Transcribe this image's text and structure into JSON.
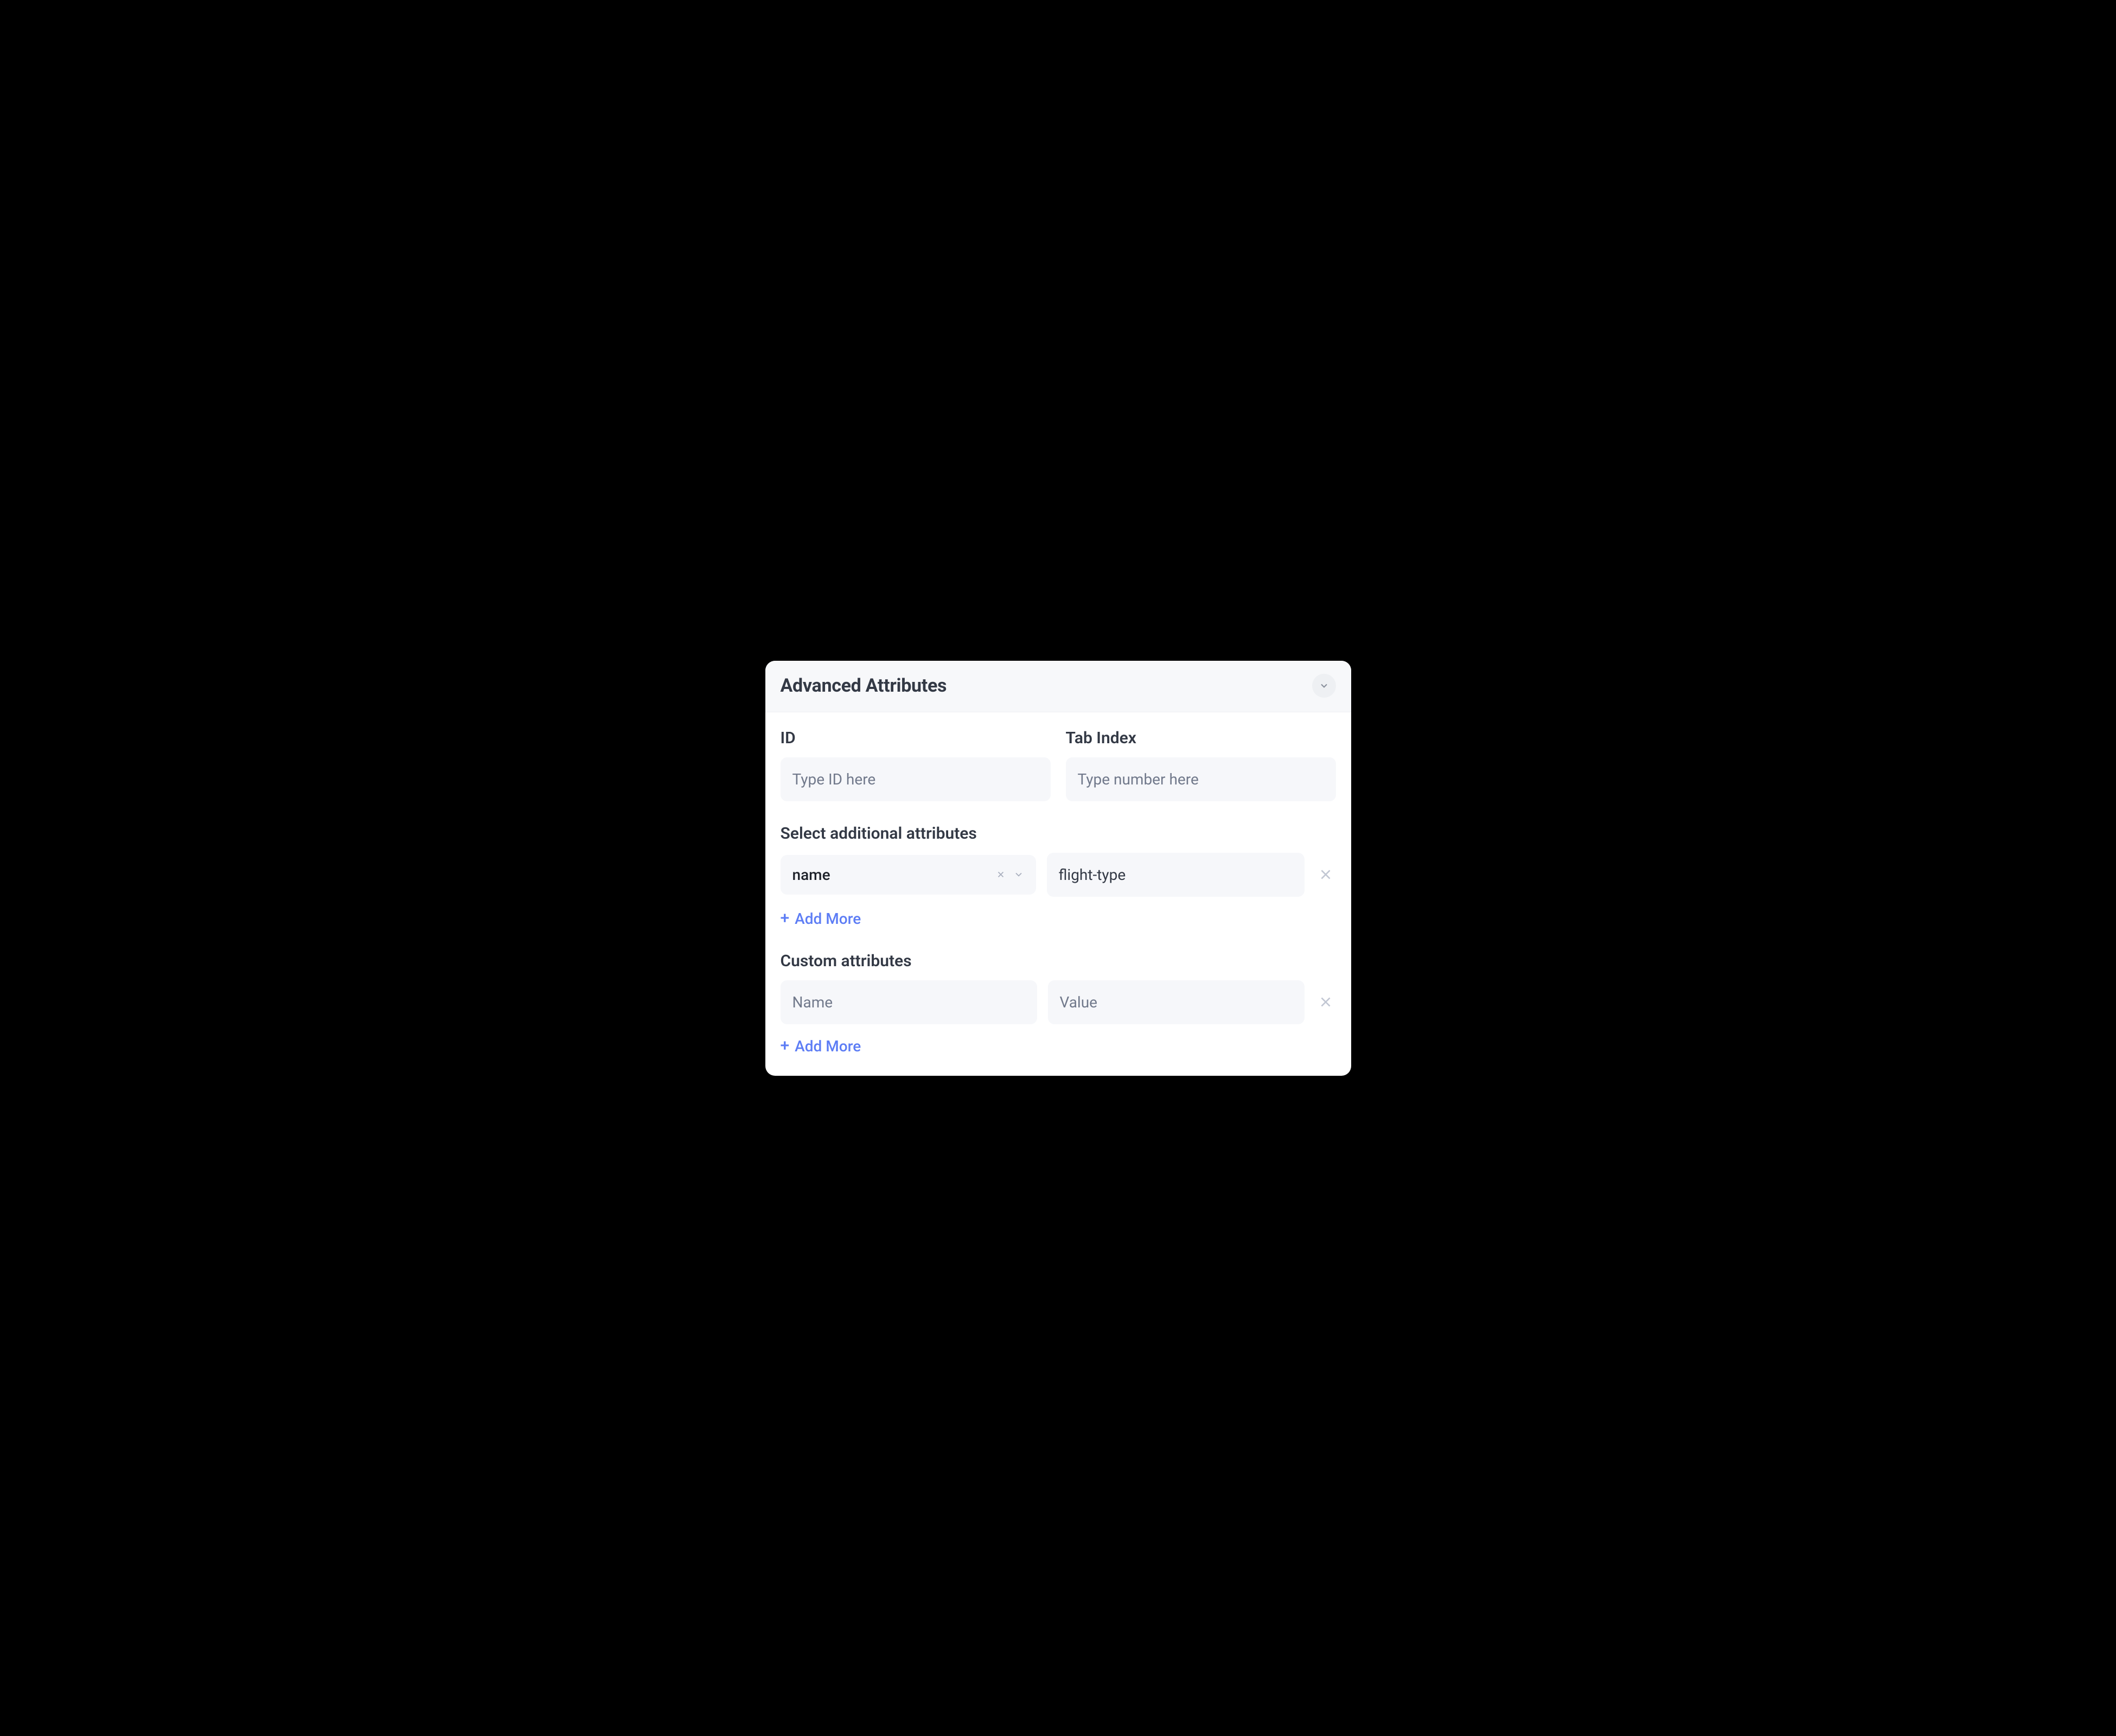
{
  "panel": {
    "title": "Advanced Attributes"
  },
  "fields": {
    "id": {
      "label": "ID",
      "placeholder": "Type ID here",
      "value": ""
    },
    "tabIndex": {
      "label": "Tab Index",
      "placeholder": "Type number here",
      "value": ""
    }
  },
  "additional": {
    "label": "Select additional attributes",
    "rows": [
      {
        "key": "name",
        "value": "flight-type"
      }
    ],
    "addMore": "Add More"
  },
  "custom": {
    "label": "Custom attributes",
    "rows": [
      {
        "namePlaceholder": "Name",
        "valuePlaceholder": "Value",
        "name": "",
        "value": ""
      }
    ],
    "addMore": "Add More"
  },
  "icons": {
    "chevronDown": "chevron-down-icon",
    "close": "close-icon",
    "plus": "+"
  }
}
